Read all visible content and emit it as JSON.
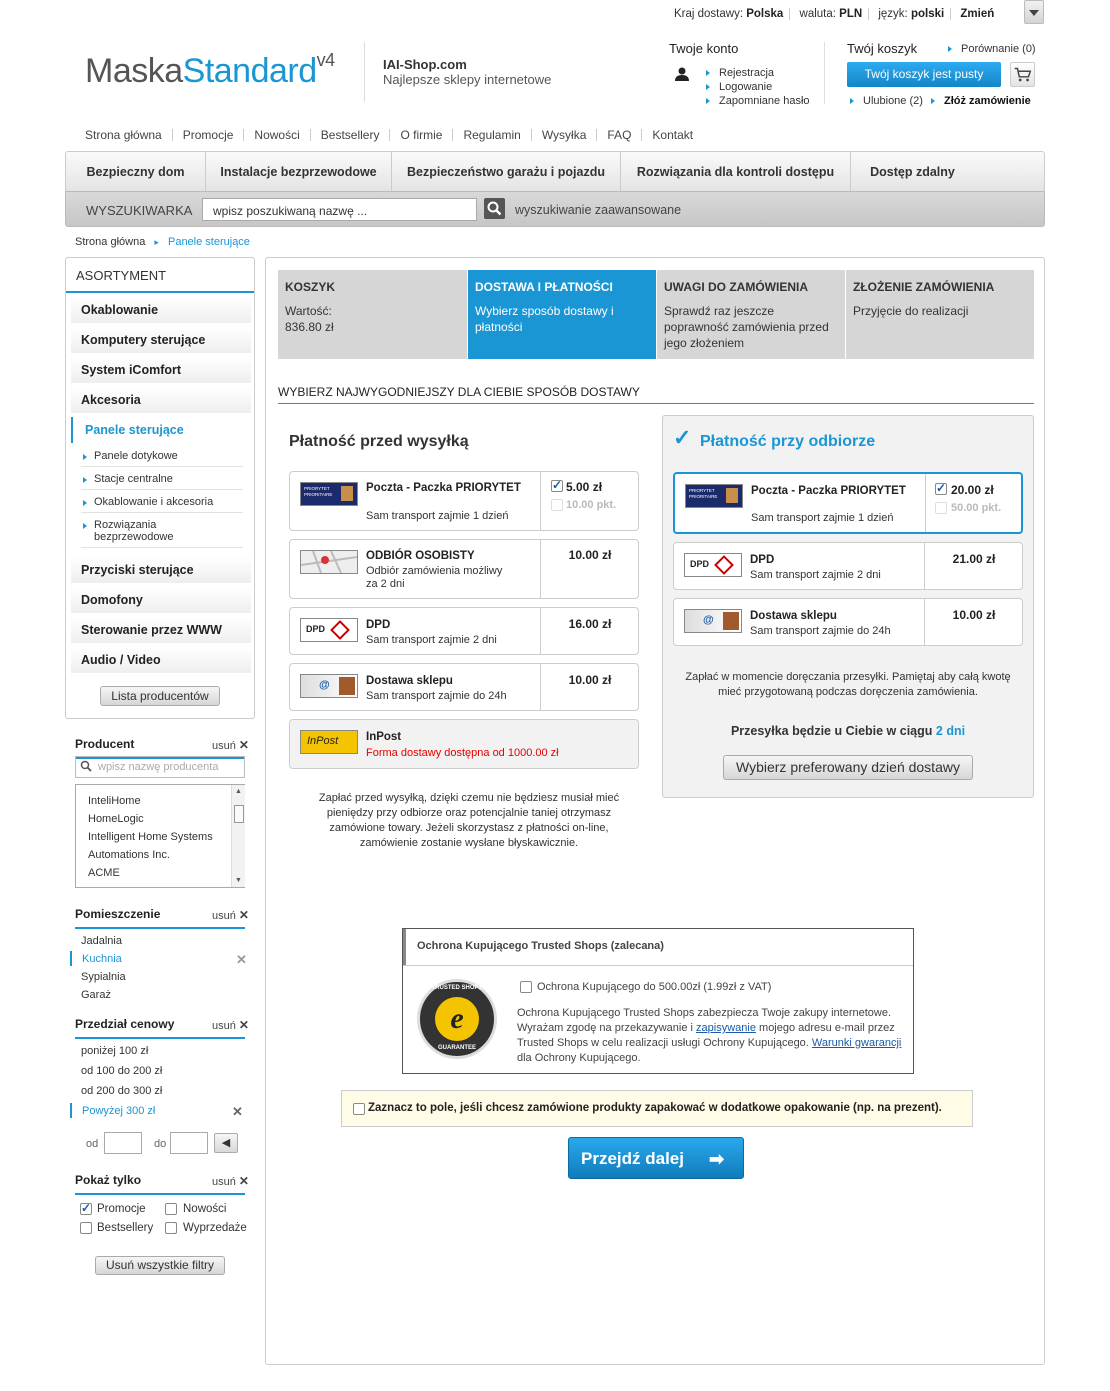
{
  "topbar": {
    "country_label": "Kraj dostawy:",
    "country_value": "Polska",
    "currency_label": "waluta:",
    "currency_value": "PLN",
    "lang_label": "język:",
    "lang_value": "polski",
    "change": "Zmień"
  },
  "header": {
    "logo_a": "Maska",
    "logo_b": "Standard",
    "logo_v": "v4",
    "shop_name": "IAI-Shop.com",
    "shop_tagline": "Najlepsze sklepy internetowe",
    "account_title": "Twoje konto",
    "account_links": [
      "Rejestracja",
      "Logowanie",
      "Zapomniane hasło"
    ],
    "cart_title": "Twój koszyk",
    "compare": "Porównanie (0)",
    "cart_button": "Twój koszyk jest pusty",
    "favorites": "Ulubione (2)",
    "order": "Złóż zamówienie"
  },
  "nav": [
    "Strona główna",
    "Promocje",
    "Nowości",
    "Bestsellery",
    "O firmie",
    "Regulamin",
    "Wysyłka",
    "FAQ",
    "Kontakt"
  ],
  "categories": [
    "Bezpieczny dom",
    "Instalacje bezprzewodowe",
    "Bezpieczeństwo garażu i pojazdu",
    "Rozwiązania dla  kontroli dostępu",
    "Dostęp zdalny"
  ],
  "search": {
    "label": "WYSZUKIWARKA",
    "placeholder": "wpisz poszukiwaną nazwę ...",
    "advanced": "wyszukiwanie zaawansowane"
  },
  "breadcrumb": {
    "home": "Strona główna",
    "current": "Panele sterujące"
  },
  "sidebar": {
    "title": "ASORTYMENT",
    "cats_top": [
      "Okablowanie",
      "Komputery sterujące",
      "System iComfort",
      "Akcesoria"
    ],
    "active": "Panele sterujące",
    "subs": [
      "Panele dotykowe",
      "Stacje centralne",
      "Okablowanie i akcesoria",
      "Rozwiązania bezprzewodowe"
    ],
    "cats_bottom": [
      "Przyciski sterujące",
      "Domofony",
      "Sterowanie przez WWW",
      "Audio / Video"
    ],
    "producers_button": "Lista producentów"
  },
  "filters": {
    "clear": "usuń",
    "producer": {
      "title": "Producent",
      "placeholder": "wpisz nazwę producenta",
      "items": [
        "InteliHome",
        "HomeLogic",
        "Intelligent Home Systems",
        "Automations Inc.",
        "ACME"
      ]
    },
    "room": {
      "title": "Pomieszczenie",
      "items": [
        "Jadalnia",
        "Kuchnia",
        "Sypialnia",
        "Garaż"
      ]
    },
    "price": {
      "title": "Przedział cenowy",
      "items": [
        "poniżej 100 zł",
        "od 100 do 200 zł",
        "od 200 do 300 zł",
        "Powyżej 300 zł"
      ],
      "from": "od",
      "to": "do"
    },
    "show": {
      "title": "Pokaż tylko",
      "items": [
        "Promocje",
        "Nowości",
        "Bestsellery",
        "Wyprzedaże"
      ]
    },
    "clear_all": "Usuń wszystkie filtry"
  },
  "steps": [
    {
      "title": "KOSZYK",
      "text": "Wartość:\n836.80 zł"
    },
    {
      "title": "DOSTAWA I PŁATNOŚCI",
      "text": "Wybierz sposób dostawy i płatności"
    },
    {
      "title": "UWAGI DO ZAMÓWIENIA",
      "text": "Sprawdź raz jeszcze poprawność zamówienia przed jego złożeniem"
    },
    {
      "title": "ZŁOŻENIE ZAMÓWIENIA",
      "text": "Przyjęcie do realizacji"
    }
  ],
  "shipping_heading": "WYBIERZ NAJWYGODNIEJSZY DLA CIEBIE SPOSÓB DOSTAWY",
  "prepaid": {
    "title": "Płatność przed wysyłką",
    "options": [
      {
        "name": "Poczta - Paczka PRIORYTET",
        "desc": "Sam transport zajmie 1 dzień",
        "price": "5.00 zł",
        "points": "10.00 pkt."
      },
      {
        "name": "ODBIÓR OSOBISTY",
        "desc": "Odbiór zamówienia możliwy za 2 dni",
        "price": "10.00 zł"
      },
      {
        "name": "DPD",
        "desc": "Sam transport zajmie 2 dni",
        "price": "16.00 zł"
      },
      {
        "name": "Dostawa sklepu",
        "desc": "Sam transport zajmie do 24h",
        "price": "10.00 zł"
      },
      {
        "name": "InPost",
        "desc": "Forma dostawy dostępna od 1000.00 zł"
      }
    ],
    "note": "Zapłać przed wysyłką, dzięki czemu nie będziesz musiał mieć pieniędzy przy odbiorze oraz potencjalnie taniej otrzymasz zamówione towary. Jeżeli skorzystasz z płatności on-line, zamówienie zostanie wysłane błyskawicznie."
  },
  "cod": {
    "title": "Płatność przy odbiorze",
    "options": [
      {
        "name": "Poczta - Paczka PRIORYTET",
        "desc": "Sam transport zajmie 1 dzień",
        "price": "20.00 zł",
        "points": "50.00 pkt."
      },
      {
        "name": "DPD",
        "desc": "Sam transport zajmie 2 dni",
        "price": "21.00 zł"
      },
      {
        "name": "Dostawa sklepu",
        "desc": "Sam transport zajmie do 24h",
        "price": "10.00 zł"
      }
    ],
    "note": "Zapłać w momencie doręczania przesyłki. Pamiętaj aby całą kwotę mieć przygotowaną podczas doręczenia zamówienia.",
    "eta_label": "Przesyłka będzie u Ciebie w ciągu",
    "eta_value": "2 dni",
    "day_button": "Wybierz preferowany dzień dostawy"
  },
  "logo_texts": {
    "priority": "PRIORYTET PRIORITAIRE",
    "dpd": "DPD",
    "inpost": "InPost"
  },
  "trusted": {
    "title": "Ochrona Kupującego Trusted Shops (zalecana)",
    "checkbox": "Ochrona Kupującego do 500.00zł (1.99zł z VAT)",
    "text_a": "Ochrona Kupującego Trusted Shops zabezpiecza Twoje zakupy internetowe. Wyrażam zgodę na przekazywanie i ",
    "link_a": "zapisywanie",
    "text_b": " mojego adresu e-mail przez Trusted Shops w celu realizacji usługi Ochrony Kupującego. ",
    "link_b": "Warunki gwarancji",
    "text_c": " dla Ochrony Kupującego.",
    "seal_letter": "e",
    "seal_top": "TRUSTED SHOPS",
    "seal_bottom": "GUARANTEE"
  },
  "gift": "Zaznacz to pole, jeśli chcesz zamówione produkty zapakować w dodatkowe opakowanie (np. na prezent).",
  "proceed": "Przejdź dalej",
  "colors": {
    "accent": "#1a96d4",
    "button": "#1486c6",
    "alert": "#e60000"
  }
}
